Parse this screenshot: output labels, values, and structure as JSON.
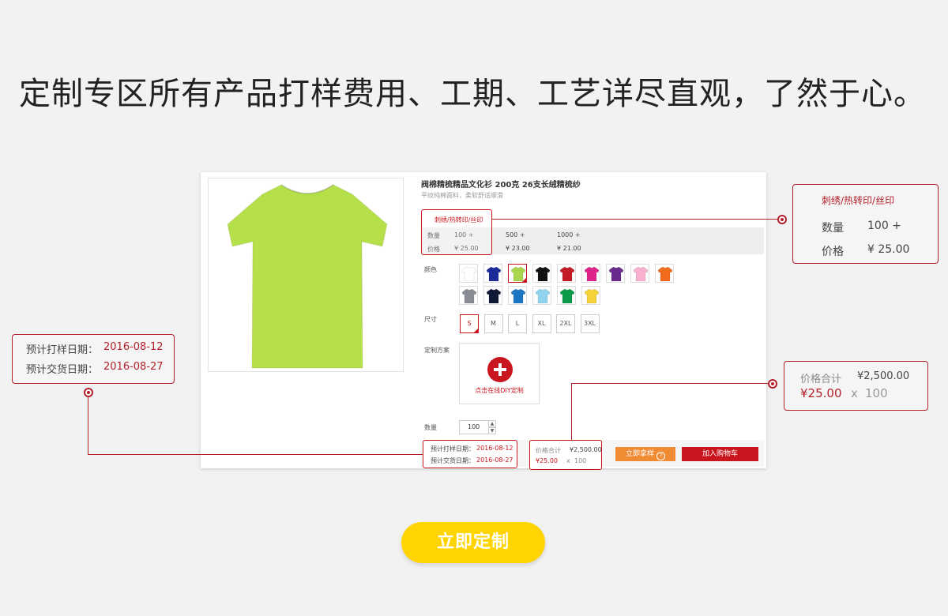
{
  "headline": "定制专区所有产品打样费用、工期、工艺详尽直观，了然于心。",
  "product": {
    "title": "阀棉精梳精品文化衫 200克 26支长绒精梳纱",
    "subtitle": "平纹纯棉面料，柔软舒适顺滑",
    "image_color": "#b5e04a",
    "craft": "刺绣/热转印/丝印",
    "qty_label": "数量",
    "price_label": "价格",
    "tiers": [
      {
        "qty": "100 +",
        "price": "¥ 25.00"
      },
      {
        "qty": "500 +",
        "price": "¥ 23.00"
      },
      {
        "qty": "1000 +",
        "price": "¥ 21.00"
      }
    ]
  },
  "color_label": "颜色",
  "colors": [
    "#ffffff",
    "#1c2a9a",
    "#a9d64a",
    "#111111",
    "#c41a26",
    "#e0238a",
    "#6a2a8c",
    "#f7b1cf",
    "#f26a1b",
    "#8a8c95",
    "#101935",
    "#1b76c4",
    "#8fd3ef",
    "#0c9a4b",
    "#f4d23a"
  ],
  "selected_color": 2,
  "size_label": "尺寸",
  "sizes": [
    "S",
    "M",
    "L",
    "XL",
    "2XL",
    "3XL"
  ],
  "selected_size": 0,
  "custom_label": "定制方案",
  "diy_text": "点击在线DIY定制",
  "quantity": {
    "label": "数量",
    "value": "100"
  },
  "schedule": {
    "sample_label": "预计打样日期：",
    "sample_date": "2016-08-12",
    "delivery_label": "预计交货日期：",
    "delivery_date": "2016-08-27"
  },
  "total": {
    "label": "价格合计",
    "amount": "¥2,500.00",
    "unit_price": "¥25.00",
    "times": "x",
    "qty": "100"
  },
  "buttons": {
    "sample": "立即拿样",
    "sample_icon": "?",
    "cart": "加入购物车"
  },
  "callout_craft": {
    "title": "刺绣/热转印/丝印",
    "qty_label": "数量",
    "qty": "100 +",
    "price_label": "价格",
    "price": "¥ 25.00"
  },
  "cta": "立即定制",
  "accent": "#c9151e",
  "cta_color": "#ffd400"
}
